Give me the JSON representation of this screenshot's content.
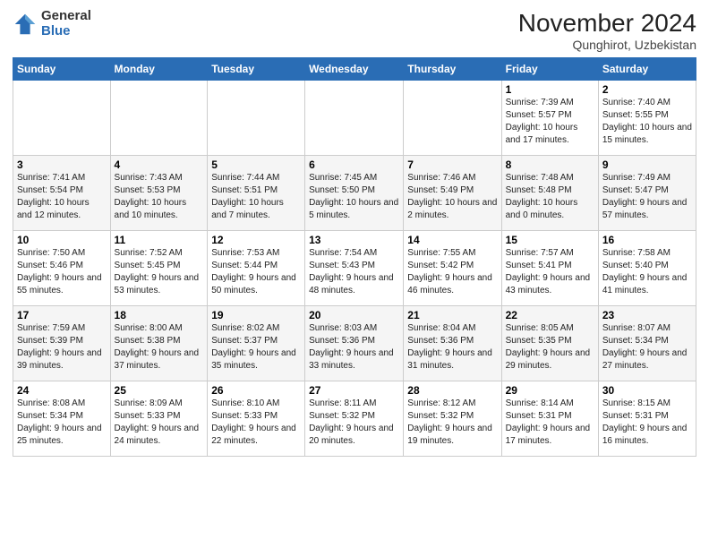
{
  "logo": {
    "general": "General",
    "blue": "Blue"
  },
  "header": {
    "month": "November 2024",
    "location": "Qunghirot, Uzbekistan"
  },
  "weekdays": [
    "Sunday",
    "Monday",
    "Tuesday",
    "Wednesday",
    "Thursday",
    "Friday",
    "Saturday"
  ],
  "weeks": [
    [
      {
        "day": "",
        "info": ""
      },
      {
        "day": "",
        "info": ""
      },
      {
        "day": "",
        "info": ""
      },
      {
        "day": "",
        "info": ""
      },
      {
        "day": "",
        "info": ""
      },
      {
        "day": "1",
        "info": "Sunrise: 7:39 AM\nSunset: 5:57 PM\nDaylight: 10 hours and 17 minutes."
      },
      {
        "day": "2",
        "info": "Sunrise: 7:40 AM\nSunset: 5:55 PM\nDaylight: 10 hours and 15 minutes."
      }
    ],
    [
      {
        "day": "3",
        "info": "Sunrise: 7:41 AM\nSunset: 5:54 PM\nDaylight: 10 hours and 12 minutes."
      },
      {
        "day": "4",
        "info": "Sunrise: 7:43 AM\nSunset: 5:53 PM\nDaylight: 10 hours and 10 minutes."
      },
      {
        "day": "5",
        "info": "Sunrise: 7:44 AM\nSunset: 5:51 PM\nDaylight: 10 hours and 7 minutes."
      },
      {
        "day": "6",
        "info": "Sunrise: 7:45 AM\nSunset: 5:50 PM\nDaylight: 10 hours and 5 minutes."
      },
      {
        "day": "7",
        "info": "Sunrise: 7:46 AM\nSunset: 5:49 PM\nDaylight: 10 hours and 2 minutes."
      },
      {
        "day": "8",
        "info": "Sunrise: 7:48 AM\nSunset: 5:48 PM\nDaylight: 10 hours and 0 minutes."
      },
      {
        "day": "9",
        "info": "Sunrise: 7:49 AM\nSunset: 5:47 PM\nDaylight: 9 hours and 57 minutes."
      }
    ],
    [
      {
        "day": "10",
        "info": "Sunrise: 7:50 AM\nSunset: 5:46 PM\nDaylight: 9 hours and 55 minutes."
      },
      {
        "day": "11",
        "info": "Sunrise: 7:52 AM\nSunset: 5:45 PM\nDaylight: 9 hours and 53 minutes."
      },
      {
        "day": "12",
        "info": "Sunrise: 7:53 AM\nSunset: 5:44 PM\nDaylight: 9 hours and 50 minutes."
      },
      {
        "day": "13",
        "info": "Sunrise: 7:54 AM\nSunset: 5:43 PM\nDaylight: 9 hours and 48 minutes."
      },
      {
        "day": "14",
        "info": "Sunrise: 7:55 AM\nSunset: 5:42 PM\nDaylight: 9 hours and 46 minutes."
      },
      {
        "day": "15",
        "info": "Sunrise: 7:57 AM\nSunset: 5:41 PM\nDaylight: 9 hours and 43 minutes."
      },
      {
        "day": "16",
        "info": "Sunrise: 7:58 AM\nSunset: 5:40 PM\nDaylight: 9 hours and 41 minutes."
      }
    ],
    [
      {
        "day": "17",
        "info": "Sunrise: 7:59 AM\nSunset: 5:39 PM\nDaylight: 9 hours and 39 minutes."
      },
      {
        "day": "18",
        "info": "Sunrise: 8:00 AM\nSunset: 5:38 PM\nDaylight: 9 hours and 37 minutes."
      },
      {
        "day": "19",
        "info": "Sunrise: 8:02 AM\nSunset: 5:37 PM\nDaylight: 9 hours and 35 minutes."
      },
      {
        "day": "20",
        "info": "Sunrise: 8:03 AM\nSunset: 5:36 PM\nDaylight: 9 hours and 33 minutes."
      },
      {
        "day": "21",
        "info": "Sunrise: 8:04 AM\nSunset: 5:36 PM\nDaylight: 9 hours and 31 minutes."
      },
      {
        "day": "22",
        "info": "Sunrise: 8:05 AM\nSunset: 5:35 PM\nDaylight: 9 hours and 29 minutes."
      },
      {
        "day": "23",
        "info": "Sunrise: 8:07 AM\nSunset: 5:34 PM\nDaylight: 9 hours and 27 minutes."
      }
    ],
    [
      {
        "day": "24",
        "info": "Sunrise: 8:08 AM\nSunset: 5:34 PM\nDaylight: 9 hours and 25 minutes."
      },
      {
        "day": "25",
        "info": "Sunrise: 8:09 AM\nSunset: 5:33 PM\nDaylight: 9 hours and 24 minutes."
      },
      {
        "day": "26",
        "info": "Sunrise: 8:10 AM\nSunset: 5:33 PM\nDaylight: 9 hours and 22 minutes."
      },
      {
        "day": "27",
        "info": "Sunrise: 8:11 AM\nSunset: 5:32 PM\nDaylight: 9 hours and 20 minutes."
      },
      {
        "day": "28",
        "info": "Sunrise: 8:12 AM\nSunset: 5:32 PM\nDaylight: 9 hours and 19 minutes."
      },
      {
        "day": "29",
        "info": "Sunrise: 8:14 AM\nSunset: 5:31 PM\nDaylight: 9 hours and 17 minutes."
      },
      {
        "day": "30",
        "info": "Sunrise: 8:15 AM\nSunset: 5:31 PM\nDaylight: 9 hours and 16 minutes."
      }
    ]
  ]
}
